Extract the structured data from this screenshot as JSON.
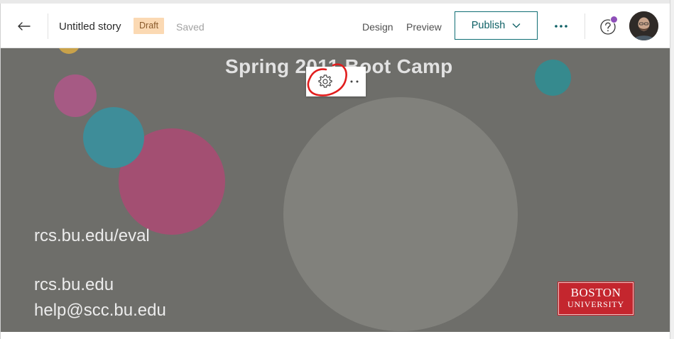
{
  "header": {
    "story_title": "Untitled story",
    "draft_badge": "Draft",
    "save_status": "Saved",
    "nav": {
      "design": "Design",
      "preview": "Preview"
    },
    "publish_label": "Publish",
    "icons": {
      "back": "arrow-left-icon",
      "publish_chevron": "chevron-down-icon",
      "more": "more-horizontal-icon",
      "help": "question-circle-icon",
      "notification_dot": "notification-dot"
    },
    "colors": {
      "draft_bg": "#fbd9b3",
      "accent": "#0f6e74",
      "notification": "#8e4fb8"
    }
  },
  "slide": {
    "subtitle": "Spring 2011 Boot Camp",
    "lines": [
      "rcs.bu.edu/eval",
      "rcs.bu.edu",
      "help@scc.bu.edu"
    ],
    "logo": {
      "line1": "BOSTON",
      "line2": "UNIVERSITY"
    },
    "colors": {
      "background": "#6e6e6a",
      "logo_red": "#c4262e",
      "annotation": "#e11d1d"
    },
    "toolbar_icons": [
      "gear-icon",
      "more-horizontal-icon"
    ]
  }
}
